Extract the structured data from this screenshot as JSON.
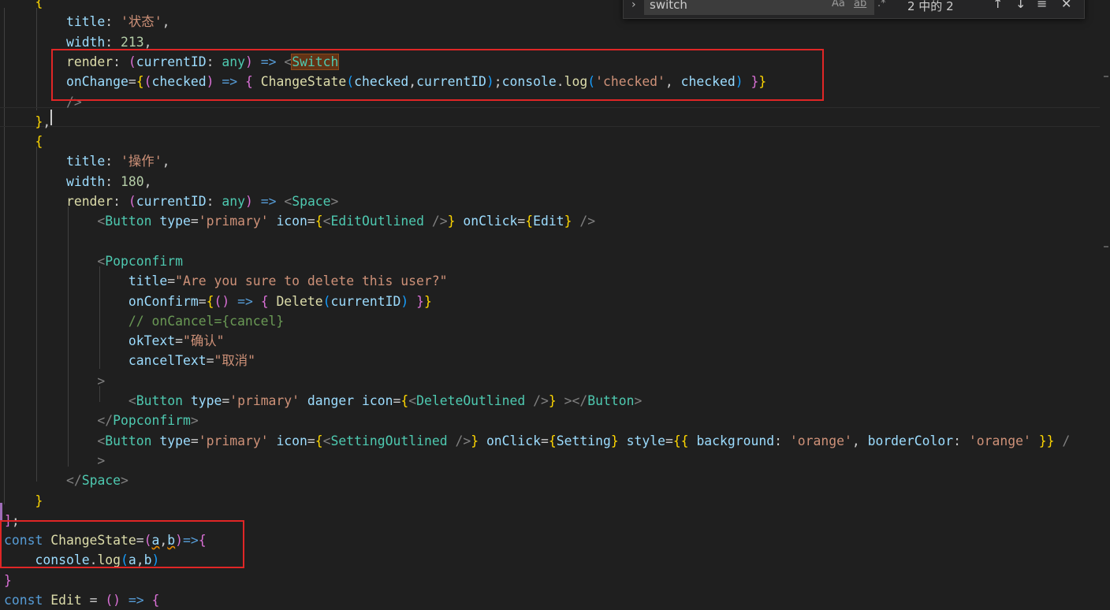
{
  "colors": {
    "background": "#1f1f1f",
    "keyword": "#569cd6",
    "control": "#c586c0",
    "variable": "#9cdcfe",
    "function": "#dcdcaa",
    "string": "#ce9178",
    "number": "#b5cea8",
    "type": "#4ec9b0",
    "comment": "#6a9955",
    "tag_punct": "#808080",
    "plain": "#cccccc",
    "bracket_gold": "#ffd700",
    "bracket_pink": "#da70d6",
    "bracket_blue": "#179fff",
    "annotation_red": "#e02626"
  },
  "find_widget": {
    "query": "switch",
    "match_case_icon": "Aa",
    "whole_word_icon": "ab",
    "regex_icon": ".*",
    "count": "2 中的 2",
    "prev_icon": "arrow-up-icon",
    "next_icon": "arrow-down-icon",
    "selection_icon": "lines-icon",
    "close_icon": "close-icon"
  },
  "code_lines": [
    {
      "indent": 4,
      "tokens": [
        {
          "t": "{",
          "c": "bracket_gold"
        }
      ]
    },
    {
      "indent": 8,
      "tokens": [
        {
          "t": "title",
          "c": "variable"
        },
        {
          "t": ": ",
          "c": "plain"
        },
        {
          "t": "'状态'",
          "c": "string"
        },
        {
          "t": ",",
          "c": "plain"
        }
      ]
    },
    {
      "indent": 8,
      "tokens": [
        {
          "t": "width",
          "c": "variable"
        },
        {
          "t": ": ",
          "c": "plain"
        },
        {
          "t": "213",
          "c": "number"
        },
        {
          "t": ",",
          "c": "plain"
        }
      ]
    },
    {
      "indent": 8,
      "tokens": [
        {
          "t": "render",
          "c": "function"
        },
        {
          "t": ": ",
          "c": "plain"
        },
        {
          "t": "(",
          "c": "bracket_pink"
        },
        {
          "t": "currentID",
          "c": "variable"
        },
        {
          "t": ": ",
          "c": "plain"
        },
        {
          "t": "any",
          "c": "type"
        },
        {
          "t": ")",
          "c": "bracket_pink"
        },
        {
          "t": " => ",
          "c": "keyword"
        },
        {
          "t": "<",
          "c": "tag_punct"
        },
        {
          "t": "Switch",
          "c": "type",
          "match": true
        }
      ]
    },
    {
      "indent": 8,
      "tokens": [
        {
          "t": "onChange",
          "c": "variable"
        },
        {
          "t": "=",
          "c": "plain"
        },
        {
          "t": "{",
          "c": "bracket_gold"
        },
        {
          "t": "(",
          "c": "bracket_pink"
        },
        {
          "t": "checked",
          "c": "variable"
        },
        {
          "t": ")",
          "c": "bracket_pink"
        },
        {
          "t": " => ",
          "c": "keyword"
        },
        {
          "t": "{",
          "c": "bracket_pink"
        },
        {
          "t": " ",
          "c": "plain"
        },
        {
          "t": "ChangeState",
          "c": "function"
        },
        {
          "t": "(",
          "c": "bracket_blue"
        },
        {
          "t": "checked",
          "c": "variable"
        },
        {
          "t": ",",
          "c": "plain"
        },
        {
          "t": "currentID",
          "c": "variable"
        },
        {
          "t": ")",
          "c": "bracket_blue"
        },
        {
          "t": ";",
          "c": "plain"
        },
        {
          "t": "console",
          "c": "variable"
        },
        {
          "t": ".",
          "c": "plain"
        },
        {
          "t": "log",
          "c": "function"
        },
        {
          "t": "(",
          "c": "bracket_blue"
        },
        {
          "t": "'checked'",
          "c": "string"
        },
        {
          "t": ", ",
          "c": "plain"
        },
        {
          "t": "checked",
          "c": "variable"
        },
        {
          "t": ")",
          "c": "bracket_blue"
        },
        {
          "t": " ",
          "c": "plain"
        },
        {
          "t": "}",
          "c": "bracket_pink"
        },
        {
          "t": "}",
          "c": "bracket_gold"
        }
      ]
    },
    {
      "indent": 8,
      "tokens": [
        {
          "t": "/>",
          "c": "tag_punct"
        }
      ]
    },
    {
      "indent": 4,
      "tokens": [
        {
          "t": "}",
          "c": "bracket_gold"
        },
        {
          "t": ",",
          "c": "plain"
        }
      ]
    },
    {
      "indent": 4,
      "tokens": [
        {
          "t": "{",
          "c": "bracket_gold"
        }
      ]
    },
    {
      "indent": 8,
      "tokens": [
        {
          "t": "title",
          "c": "variable"
        },
        {
          "t": ": ",
          "c": "plain"
        },
        {
          "t": "'操作'",
          "c": "string"
        },
        {
          "t": ",",
          "c": "plain"
        }
      ]
    },
    {
      "indent": 8,
      "tokens": [
        {
          "t": "width",
          "c": "variable"
        },
        {
          "t": ": ",
          "c": "plain"
        },
        {
          "t": "180",
          "c": "number"
        },
        {
          "t": ",",
          "c": "plain"
        }
      ]
    },
    {
      "indent": 8,
      "tokens": [
        {
          "t": "render",
          "c": "function"
        },
        {
          "t": ": ",
          "c": "plain"
        },
        {
          "t": "(",
          "c": "bracket_pink"
        },
        {
          "t": "currentID",
          "c": "variable"
        },
        {
          "t": ": ",
          "c": "plain"
        },
        {
          "t": "any",
          "c": "type"
        },
        {
          "t": ")",
          "c": "bracket_pink"
        },
        {
          "t": " => ",
          "c": "keyword"
        },
        {
          "t": "<",
          "c": "tag_punct"
        },
        {
          "t": "Space",
          "c": "type"
        },
        {
          "t": ">",
          "c": "tag_punct"
        }
      ]
    },
    {
      "indent": 12,
      "tokens": [
        {
          "t": "<",
          "c": "tag_punct"
        },
        {
          "t": "Button",
          "c": "type"
        },
        {
          "t": " ",
          "c": "plain"
        },
        {
          "t": "type",
          "c": "variable"
        },
        {
          "t": "=",
          "c": "plain"
        },
        {
          "t": "'primary'",
          "c": "string"
        },
        {
          "t": " ",
          "c": "plain"
        },
        {
          "t": "icon",
          "c": "variable"
        },
        {
          "t": "=",
          "c": "plain"
        },
        {
          "t": "{",
          "c": "bracket_gold"
        },
        {
          "t": "<",
          "c": "tag_punct"
        },
        {
          "t": "EditOutlined",
          "c": "type"
        },
        {
          "t": " />",
          "c": "tag_punct"
        },
        {
          "t": "}",
          "c": "bracket_gold"
        },
        {
          "t": " ",
          "c": "plain"
        },
        {
          "t": "onClick",
          "c": "variable"
        },
        {
          "t": "=",
          "c": "plain"
        },
        {
          "t": "{",
          "c": "bracket_gold"
        },
        {
          "t": "Edit",
          "c": "variable"
        },
        {
          "t": "}",
          "c": "bracket_gold"
        },
        {
          "t": " />",
          "c": "tag_punct"
        }
      ]
    },
    {
      "indent": 0,
      "tokens": []
    },
    {
      "indent": 12,
      "tokens": [
        {
          "t": "<",
          "c": "tag_punct"
        },
        {
          "t": "Popconfirm",
          "c": "type"
        }
      ]
    },
    {
      "indent": 16,
      "tokens": [
        {
          "t": "title",
          "c": "variable"
        },
        {
          "t": "=",
          "c": "plain"
        },
        {
          "t": "\"Are you sure to delete this user?\"",
          "c": "string"
        }
      ]
    },
    {
      "indent": 16,
      "tokens": [
        {
          "t": "onConfirm",
          "c": "variable"
        },
        {
          "t": "=",
          "c": "plain"
        },
        {
          "t": "{",
          "c": "bracket_gold"
        },
        {
          "t": "()",
          "c": "bracket_pink"
        },
        {
          "t": " => ",
          "c": "keyword"
        },
        {
          "t": "{",
          "c": "bracket_pink"
        },
        {
          "t": " ",
          "c": "plain"
        },
        {
          "t": "Delete",
          "c": "function"
        },
        {
          "t": "(",
          "c": "bracket_blue"
        },
        {
          "t": "currentID",
          "c": "variable"
        },
        {
          "t": ")",
          "c": "bracket_blue"
        },
        {
          "t": " ",
          "c": "plain"
        },
        {
          "t": "}",
          "c": "bracket_pink"
        },
        {
          "t": "}",
          "c": "bracket_gold"
        }
      ]
    },
    {
      "indent": 16,
      "tokens": [
        {
          "t": "// onCancel={cancel}",
          "c": "comment"
        }
      ]
    },
    {
      "indent": 16,
      "tokens": [
        {
          "t": "okText",
          "c": "variable"
        },
        {
          "t": "=",
          "c": "plain"
        },
        {
          "t": "\"确认\"",
          "c": "string"
        }
      ]
    },
    {
      "indent": 16,
      "tokens": [
        {
          "t": "cancelText",
          "c": "variable"
        },
        {
          "t": "=",
          "c": "plain"
        },
        {
          "t": "\"取消\"",
          "c": "string"
        }
      ]
    },
    {
      "indent": 12,
      "tokens": [
        {
          "t": ">",
          "c": "tag_punct"
        }
      ]
    },
    {
      "indent": 16,
      "tokens": [
        {
          "t": "<",
          "c": "tag_punct"
        },
        {
          "t": "Button",
          "c": "type"
        },
        {
          "t": " ",
          "c": "plain"
        },
        {
          "t": "type",
          "c": "variable"
        },
        {
          "t": "=",
          "c": "plain"
        },
        {
          "t": "'primary'",
          "c": "string"
        },
        {
          "t": " ",
          "c": "plain"
        },
        {
          "t": "danger",
          "c": "variable"
        },
        {
          "t": " ",
          "c": "plain"
        },
        {
          "t": "icon",
          "c": "variable"
        },
        {
          "t": "=",
          "c": "plain"
        },
        {
          "t": "{",
          "c": "bracket_gold"
        },
        {
          "t": "<",
          "c": "tag_punct"
        },
        {
          "t": "DeleteOutlined",
          "c": "type"
        },
        {
          "t": " />",
          "c": "tag_punct"
        },
        {
          "t": "}",
          "c": "bracket_gold"
        },
        {
          "t": " ></",
          "c": "tag_punct"
        },
        {
          "t": "Button",
          "c": "type"
        },
        {
          "t": ">",
          "c": "tag_punct"
        }
      ]
    },
    {
      "indent": 12,
      "tokens": [
        {
          "t": "</",
          "c": "tag_punct"
        },
        {
          "t": "Popconfirm",
          "c": "type"
        },
        {
          "t": ">",
          "c": "tag_punct"
        }
      ]
    },
    {
      "indent": 12,
      "tokens": [
        {
          "t": "<",
          "c": "tag_punct"
        },
        {
          "t": "Button",
          "c": "type"
        },
        {
          "t": " ",
          "c": "plain"
        },
        {
          "t": "type",
          "c": "variable"
        },
        {
          "t": "=",
          "c": "plain"
        },
        {
          "t": "'primary'",
          "c": "string"
        },
        {
          "t": " ",
          "c": "plain"
        },
        {
          "t": "icon",
          "c": "variable"
        },
        {
          "t": "=",
          "c": "plain"
        },
        {
          "t": "{",
          "c": "bracket_gold"
        },
        {
          "t": "<",
          "c": "tag_punct"
        },
        {
          "t": "SettingOutlined",
          "c": "type"
        },
        {
          "t": " />",
          "c": "tag_punct"
        },
        {
          "t": "}",
          "c": "bracket_gold"
        },
        {
          "t": " ",
          "c": "plain"
        },
        {
          "t": "onClick",
          "c": "variable"
        },
        {
          "t": "=",
          "c": "plain"
        },
        {
          "t": "{",
          "c": "bracket_gold"
        },
        {
          "t": "Setting",
          "c": "variable"
        },
        {
          "t": "}",
          "c": "bracket_gold"
        },
        {
          "t": " ",
          "c": "plain"
        },
        {
          "t": "style",
          "c": "variable"
        },
        {
          "t": "=",
          "c": "plain"
        },
        {
          "t": "{{",
          "c": "bracket_gold"
        },
        {
          "t": " ",
          "c": "plain"
        },
        {
          "t": "background",
          "c": "variable"
        },
        {
          "t": ": ",
          "c": "plain"
        },
        {
          "t": "'orange'",
          "c": "string"
        },
        {
          "t": ", ",
          "c": "plain"
        },
        {
          "t": "borderColor",
          "c": "variable"
        },
        {
          "t": ": ",
          "c": "plain"
        },
        {
          "t": "'orange'",
          "c": "string"
        },
        {
          "t": " ",
          "c": "plain"
        },
        {
          "t": "}}",
          "c": "bracket_gold"
        },
        {
          "t": " /",
          "c": "tag_punct"
        }
      ]
    },
    {
      "indent": 12,
      "tokens": [
        {
          "t": ">",
          "c": "tag_punct"
        }
      ]
    },
    {
      "indent": 8,
      "tokens": [
        {
          "t": "</",
          "c": "tag_punct"
        },
        {
          "t": "Space",
          "c": "type"
        },
        {
          "t": ">",
          "c": "tag_punct"
        }
      ]
    },
    {
      "indent": 4,
      "tokens": [
        {
          "t": "}",
          "c": "bracket_gold"
        }
      ]
    },
    {
      "indent": 0,
      "tokens": [
        {
          "t": "]",
          "c": "bracket_pink"
        },
        {
          "t": ";",
          "c": "plain"
        }
      ]
    },
    {
      "indent": 0,
      "tokens": [
        {
          "t": "const",
          "c": "keyword"
        },
        {
          "t": " ",
          "c": "plain"
        },
        {
          "t": "ChangeState",
          "c": "function"
        },
        {
          "t": "=",
          "c": "plain"
        },
        {
          "t": "(",
          "c": "bracket_pink"
        },
        {
          "t": "a",
          "c": "variable",
          "squiggle": true
        },
        {
          "t": ",",
          "c": "plain"
        },
        {
          "t": "b",
          "c": "variable",
          "squiggle": true
        },
        {
          "t": ")",
          "c": "bracket_pink"
        },
        {
          "t": "=>",
          "c": "keyword"
        },
        {
          "t": "{",
          "c": "bracket_pink"
        }
      ]
    },
    {
      "indent": 4,
      "tokens": [
        {
          "t": "console",
          "c": "variable"
        },
        {
          "t": ".",
          "c": "plain"
        },
        {
          "t": "log",
          "c": "function"
        },
        {
          "t": "(",
          "c": "bracket_blue"
        },
        {
          "t": "a",
          "c": "variable"
        },
        {
          "t": ",",
          "c": "plain"
        },
        {
          "t": "b",
          "c": "variable"
        },
        {
          "t": ")",
          "c": "bracket_blue"
        }
      ]
    },
    {
      "indent": 0,
      "tokens": [
        {
          "t": "}",
          "c": "bracket_pink"
        }
      ]
    },
    {
      "indent": 0,
      "tokens": [
        {
          "t": "const",
          "c": "keyword"
        },
        {
          "t": " ",
          "c": "plain"
        },
        {
          "t": "Edit",
          "c": "function"
        },
        {
          "t": " = ",
          "c": "plain"
        },
        {
          "t": "()",
          "c": "bracket_pink"
        },
        {
          "t": " => ",
          "c": "keyword"
        },
        {
          "t": "{",
          "c": "bracket_pink"
        }
      ]
    }
  ]
}
